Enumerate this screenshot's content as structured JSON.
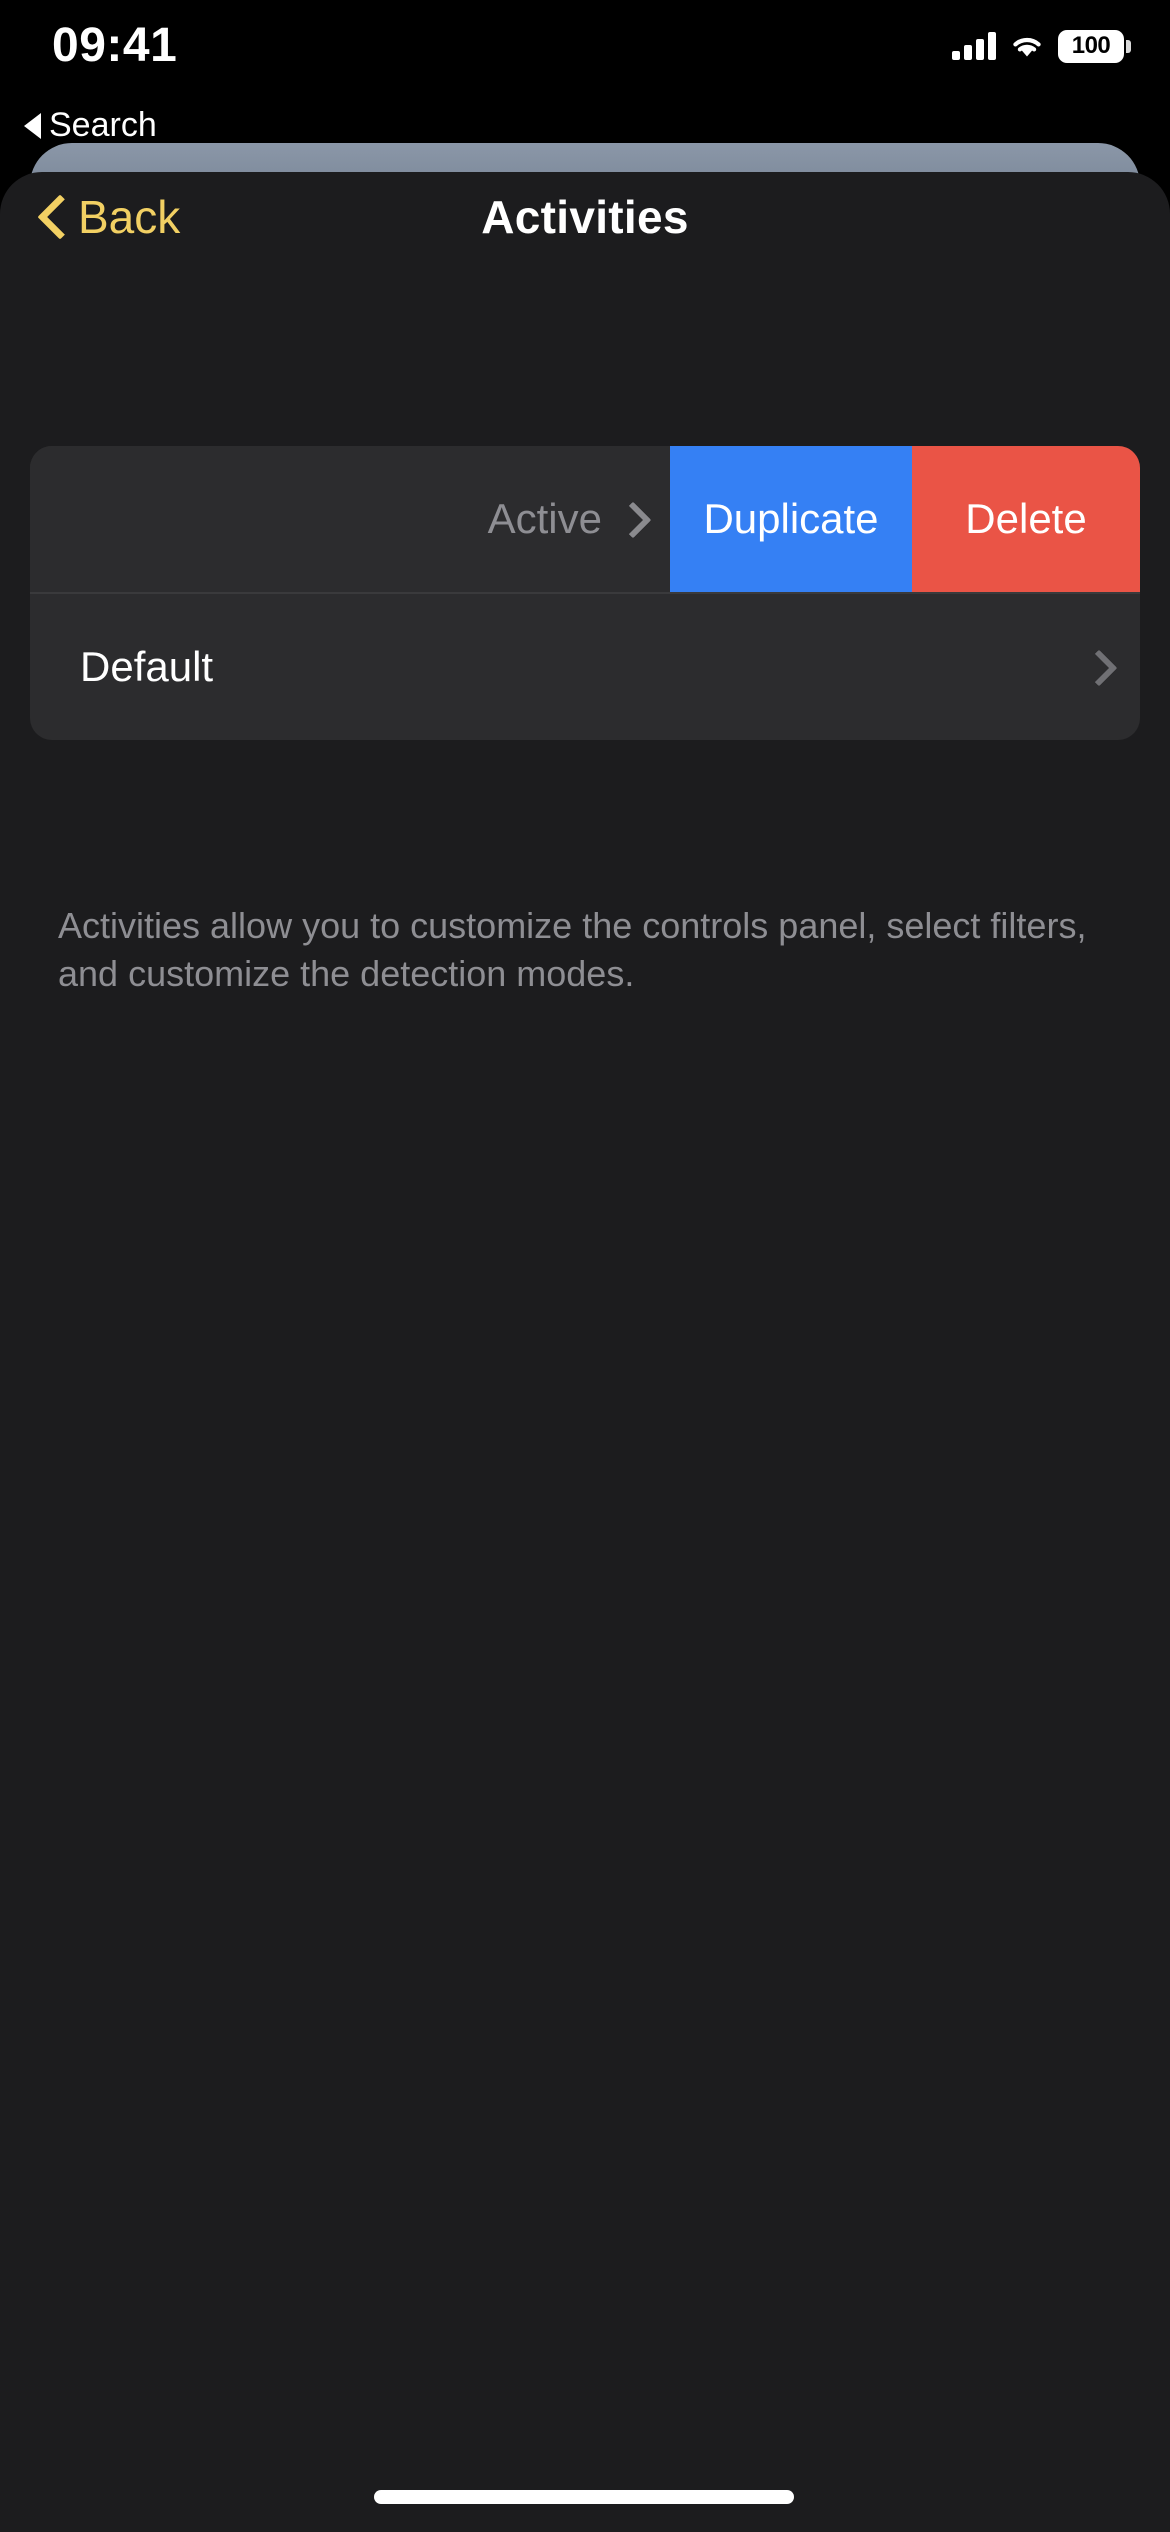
{
  "status_bar": {
    "time": "09:41",
    "battery_level": "100",
    "signal_icon": "cellular-bars-icon",
    "wifi_icon": "wifi-icon",
    "battery_icon": "battery-icon"
  },
  "back_to_app": {
    "label": "Search",
    "icon": "triangle-left-icon"
  },
  "navbar": {
    "back_label": "Back",
    "back_icon": "chevron-left-icon",
    "title": "Activities"
  },
  "list": {
    "rows": [
      {
        "label": "",
        "value": "Active",
        "disclosure_icon": "chevron-right-icon",
        "swiped": true
      },
      {
        "label": "Default",
        "value": "",
        "disclosure_icon": "chevron-right-icon",
        "swiped": false
      }
    ],
    "swipe_actions": [
      {
        "label": "Duplicate",
        "color": "#3580f4"
      },
      {
        "label": "Delete",
        "color": "#ea5446"
      }
    ],
    "footer_note": "Activities allow you to customize the controls panel, select filters, and customize the detection modes."
  },
  "colors": {
    "accent": "#f2d063",
    "sheet_background": "#1c1c1e",
    "cell_background": "#2c2c2e",
    "secondary_text": "#8e8e93",
    "duplicate": "#3580f4",
    "delete": "#ea5446"
  },
  "home_indicator": "home-indicator"
}
